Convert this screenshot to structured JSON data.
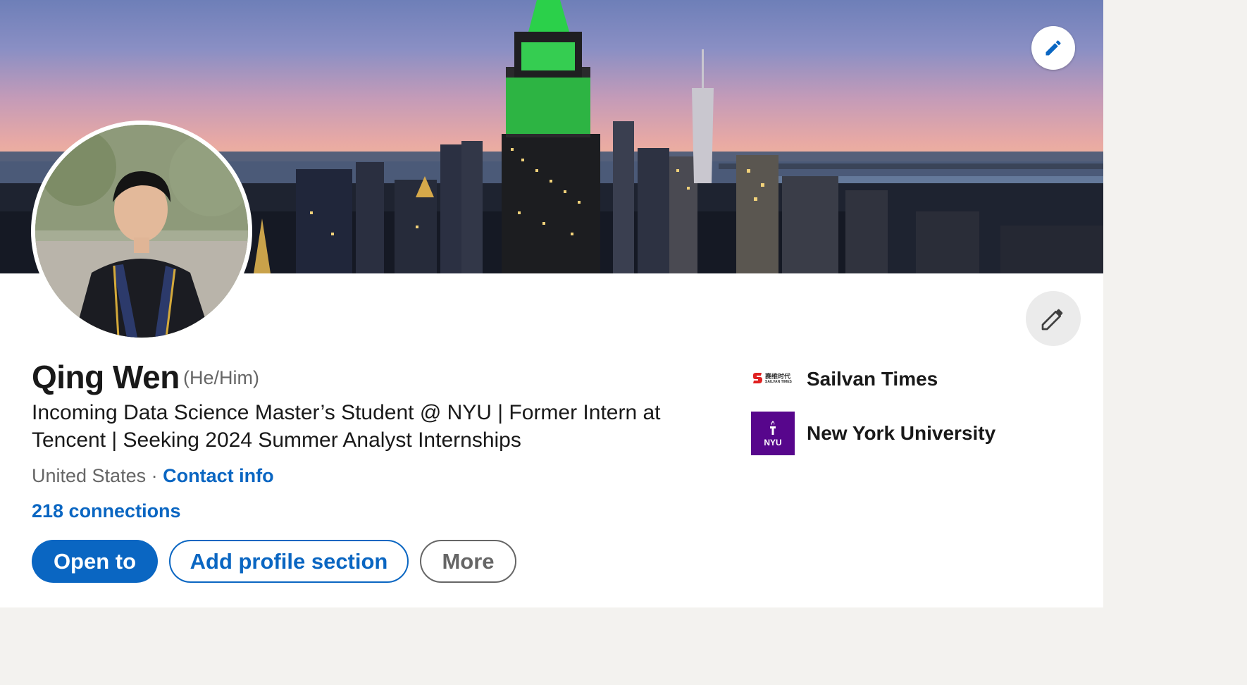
{
  "profile": {
    "name": "Qing Wen",
    "pronouns": "(He/Him)",
    "headline": "Incoming Data Science Master’s Student @ NYU | Former Intern at Tencent | Seeking 2024 Summer Analyst Internships",
    "location": "United States",
    "separator": "·",
    "contact_info": "Contact info",
    "connections": "218 connections"
  },
  "actions": {
    "open_to": "Open to",
    "add_profile_section": "Add profile section",
    "more": "More"
  },
  "organizations": [
    {
      "name": "Sailvan Times",
      "logo_text": "赛维时代",
      "logo_sub": "SAILVAN TIMES",
      "logo_color": "#e02020"
    },
    {
      "name": "New York University",
      "logo_text": "NYU",
      "logo_color": "#57068c"
    }
  ],
  "icons": {
    "edit_banner": "pencil-icon",
    "edit_intro": "pencil-icon"
  },
  "colors": {
    "link": "#0a66c2",
    "text": "#191919",
    "muted": "#666666",
    "nyu": "#57068c"
  }
}
